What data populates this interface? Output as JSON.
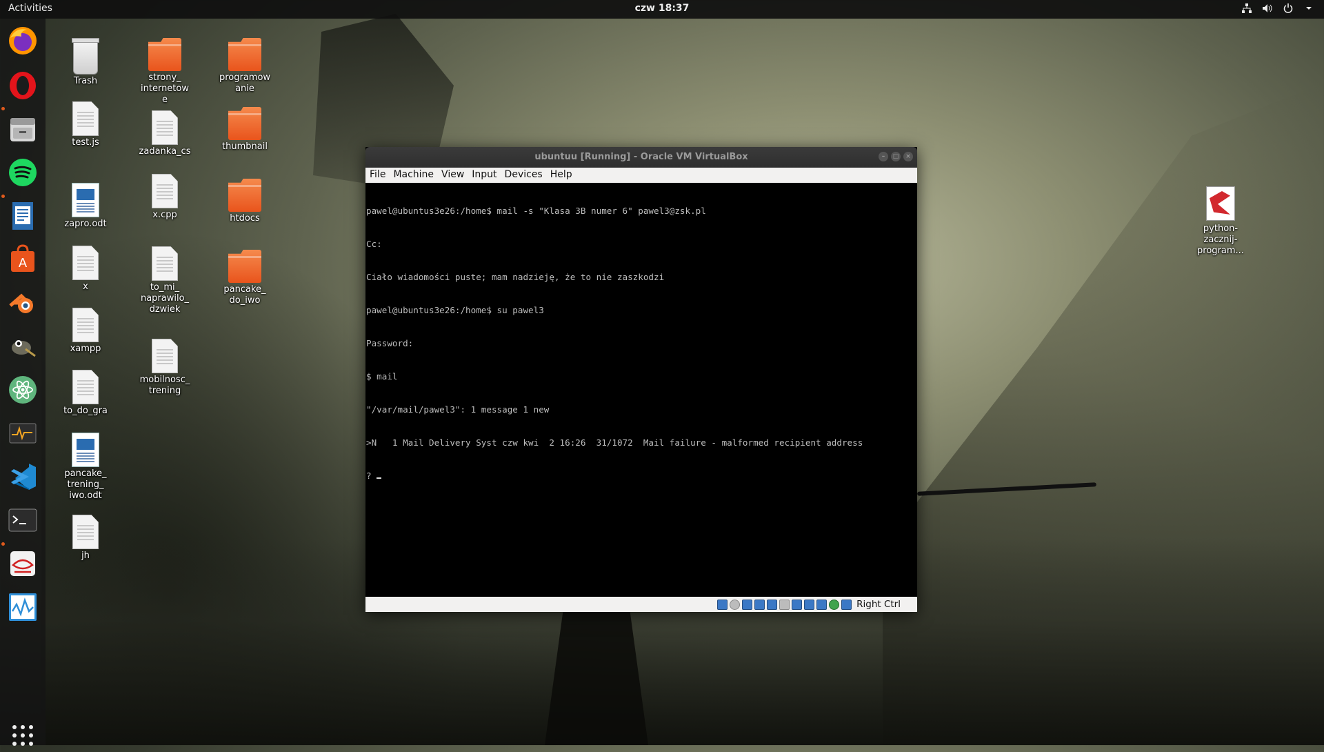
{
  "topbar": {
    "activities": "Activities",
    "clock": "czw 18:37",
    "tray_icons": [
      "network-icon",
      "volume-icon",
      "power-icon",
      "chevron-down-icon"
    ]
  },
  "dock": {
    "apps": [
      "Firefox",
      "Opera",
      "Files",
      "Spotify",
      "LibreOffice Writer",
      "Ubuntu Software",
      "Blender",
      "GIMP",
      "Atom",
      "System Monitor",
      "Visual Studio Code",
      "Terminal",
      "Evince",
      "Pulse"
    ],
    "show_apps_icon": "grid-icon"
  },
  "desktop_icons": [
    {
      "label": "Trash",
      "kind": "trash"
    },
    {
      "label": "strony_\ninternetow\ne",
      "kind": "folder"
    },
    {
      "label": "programow\nanie",
      "kind": "folder"
    },
    {
      "label": "test.js",
      "kind": "doc"
    },
    {
      "label": "zadanka_cs",
      "kind": "doc"
    },
    {
      "label": "thumbnail",
      "kind": "folder"
    },
    {
      "label": "zapro.odt",
      "kind": "odt"
    },
    {
      "label": "x.cpp",
      "kind": "doc"
    },
    {
      "label": "htdocs",
      "kind": "folder"
    },
    {
      "label": "x",
      "kind": "doc"
    },
    {
      "label": "to_mi_\nnaprawilo_\ndzwiek",
      "kind": "doc"
    },
    {
      "label": "pancake_\ndo_iwo",
      "kind": "folder"
    },
    {
      "label": "xampp",
      "kind": "doc"
    },
    {
      "label": "mobilnosc_\ntrening",
      "kind": "doc"
    },
    {
      "label": "to_do_gra",
      "kind": "doc"
    },
    {
      "label": "pancake_\ntrening_\niwo.odt",
      "kind": "odt"
    },
    {
      "label": "jh",
      "kind": "doc"
    },
    {
      "label": "python-\nzacznij-\nprogram...",
      "kind": "pdf"
    }
  ],
  "vbox": {
    "title": "ubuntuu [Running] - Oracle VM VirtualBox",
    "menu": [
      "File",
      "Machine",
      "View",
      "Input",
      "Devices",
      "Help"
    ],
    "terminal_lines": [
      "pawel@ubuntus3e26:/home$ mail -s \"Klasa 3B numer 6\" pawel3@zsk.pl",
      "Cc:",
      "Ciało wiadomości puste; mam nadzieję, że to nie zaszkodzi",
      "pawel@ubuntus3e26:/home$ su pawel3",
      "Password:",
      "$ mail",
      "\"/var/mail/pawel3\": 1 message 1 new",
      ">N   1 Mail Delivery Syst czw kwi  2 16:26  31/1072  Mail failure - malformed recipient address",
      "? "
    ],
    "host_key": "Right Ctrl"
  }
}
